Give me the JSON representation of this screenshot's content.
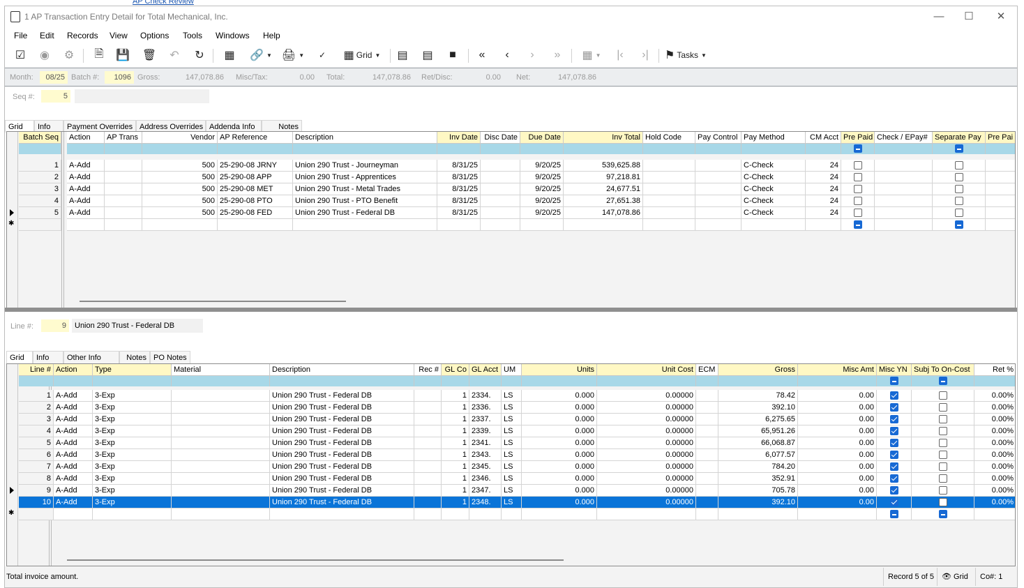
{
  "background_link": "AP Check Review",
  "window": {
    "title": "1 AP Transaction Entry Detail for Total Mechanical, Inc."
  },
  "menu": [
    "File",
    "Edit",
    "Records",
    "View",
    "Options",
    "Tools",
    "Windows",
    "Help"
  ],
  "toolbar": {
    "grid_label": "Grid",
    "tasks_label": "Tasks"
  },
  "header": {
    "month_label": "Month:",
    "month": "08/25",
    "batch_label": "Batch #:",
    "batch": "1096",
    "gross_label": "Gross:",
    "gross": "147,078.86",
    "misctax_label": "Misc/Tax:",
    "misctax": "0.00",
    "total_label": "Total:",
    "total": "147,078.86",
    "retdisc_label": "Ret/Disc:",
    "retdisc": "0.00",
    "net_label": "Net:",
    "net": "147,078.86"
  },
  "seq": {
    "label": "Seq #:",
    "value": "5",
    "desc": ""
  },
  "top_tabs": [
    "Grid",
    "Info",
    "Payment Overrides",
    "Address Overrides",
    "Addenda Info",
    "Notes"
  ],
  "top_grid": {
    "columns": [
      "Batch Seq",
      "Action",
      "AP Trans",
      "Vendor",
      "AP Reference",
      "Description",
      "Inv Date",
      "Disc Date",
      "Due Date",
      "Inv Total",
      "Hold Code",
      "Pay Control",
      "Pay Method",
      "CM Acct",
      "Pre Paid",
      "Check / EPay#",
      "Separate Pay",
      "Pre Pai"
    ],
    "rows": [
      {
        "seq": "1",
        "action": "A-Add",
        "aptrans": "",
        "vendor": "500",
        "ref": "25-290-08 JRNY",
        "desc": "Union 290 Trust - Journeyman",
        "invdate": "8/31/25",
        "discdate": "",
        "duedate": "9/20/25",
        "invtotal": "539,625.88",
        "hold": "",
        "paycontrol": "",
        "paymethod": "C-Check",
        "cmacct": "24"
      },
      {
        "seq": "2",
        "action": "A-Add",
        "aptrans": "",
        "vendor": "500",
        "ref": "25-290-08 APP",
        "desc": "Union 290 Trust - Apprentices",
        "invdate": "8/31/25",
        "discdate": "",
        "duedate": "9/20/25",
        "invtotal": "97,218.81",
        "hold": "",
        "paycontrol": "",
        "paymethod": "C-Check",
        "cmacct": "24"
      },
      {
        "seq": "3",
        "action": "A-Add",
        "aptrans": "",
        "vendor": "500",
        "ref": "25-290-08 MET",
        "desc": "Union 290 Trust - Metal Trades",
        "invdate": "8/31/25",
        "discdate": "",
        "duedate": "9/20/25",
        "invtotal": "24,677.51",
        "hold": "",
        "paycontrol": "",
        "paymethod": "C-Check",
        "cmacct": "24"
      },
      {
        "seq": "4",
        "action": "A-Add",
        "aptrans": "",
        "vendor": "500",
        "ref": "25-290-08 PTO",
        "desc": "Union 290 Trust - PTO Benefit",
        "invdate": "8/31/25",
        "discdate": "",
        "duedate": "9/20/25",
        "invtotal": "27,651.38",
        "hold": "",
        "paycontrol": "",
        "paymethod": "C-Check",
        "cmacct": "24"
      },
      {
        "seq": "5",
        "action": "A-Add",
        "aptrans": "",
        "vendor": "500",
        "ref": "25-290-08 FED",
        "desc": "Union 290 Trust - Federal DB",
        "invdate": "8/31/25",
        "discdate": "",
        "duedate": "9/20/25",
        "invtotal": "147,078.86",
        "hold": "",
        "paycontrol": "",
        "paymethod": "C-Check",
        "cmacct": "24"
      }
    ]
  },
  "line": {
    "label": "Line #:",
    "value": "9",
    "desc": "Union 290 Trust - Federal DB"
  },
  "bottom_tabs": [
    "Grid",
    "Info",
    "Other Info",
    "Notes",
    "PO Notes"
  ],
  "bottom_grid": {
    "columns": [
      "Line #",
      "Action",
      "Type",
      "Material",
      "Description",
      "Rec #",
      "GL Co",
      "GL Acct",
      "UM",
      "Units",
      "Unit Cost",
      "ECM",
      "Gross",
      "Misc Amt",
      "Misc YN",
      "Subj To On-Cost",
      "Ret %"
    ],
    "rows": [
      {
        "line": "1",
        "action": "A-Add",
        "type": "3-Exp",
        "material": "",
        "desc": "Union 290 Trust - Federal DB",
        "rec": "",
        "glco": "1",
        "glacct": "2334.",
        "um": "LS",
        "units": "0.000",
        "unitcost": "0.00000",
        "ecm": "",
        "gross": "78.42",
        "miscamt": "0.00",
        "ret": "0.00%"
      },
      {
        "line": "2",
        "action": "A-Add",
        "type": "3-Exp",
        "material": "",
        "desc": "Union 290 Trust - Federal DB",
        "rec": "",
        "glco": "1",
        "glacct": "2336.",
        "um": "LS",
        "units": "0.000",
        "unitcost": "0.00000",
        "ecm": "",
        "gross": "392.10",
        "miscamt": "0.00",
        "ret": "0.00%"
      },
      {
        "line": "3",
        "action": "A-Add",
        "type": "3-Exp",
        "material": "",
        "desc": "Union 290 Trust - Federal DB",
        "rec": "",
        "glco": "1",
        "glacct": "2337.",
        "um": "LS",
        "units": "0.000",
        "unitcost": "0.00000",
        "ecm": "",
        "gross": "6,275.65",
        "miscamt": "0.00",
        "ret": "0.00%"
      },
      {
        "line": "4",
        "action": "A-Add",
        "type": "3-Exp",
        "material": "",
        "desc": "Union 290 Trust - Federal DB",
        "rec": "",
        "glco": "1",
        "glacct": "2339.",
        "um": "LS",
        "units": "0.000",
        "unitcost": "0.00000",
        "ecm": "",
        "gross": "65,951.26",
        "miscamt": "0.00",
        "ret": "0.00%"
      },
      {
        "line": "5",
        "action": "A-Add",
        "type": "3-Exp",
        "material": "",
        "desc": "Union 290 Trust - Federal DB",
        "rec": "",
        "glco": "1",
        "glacct": "2341.",
        "um": "LS",
        "units": "0.000",
        "unitcost": "0.00000",
        "ecm": "",
        "gross": "66,068.87",
        "miscamt": "0.00",
        "ret": "0.00%"
      },
      {
        "line": "6",
        "action": "A-Add",
        "type": "3-Exp",
        "material": "",
        "desc": "Union 290 Trust - Federal DB",
        "rec": "",
        "glco": "1",
        "glacct": "2343.",
        "um": "LS",
        "units": "0.000",
        "unitcost": "0.00000",
        "ecm": "",
        "gross": "6,077.57",
        "miscamt": "0.00",
        "ret": "0.00%"
      },
      {
        "line": "7",
        "action": "A-Add",
        "type": "3-Exp",
        "material": "",
        "desc": "Union 290 Trust - Federal DB",
        "rec": "",
        "glco": "1",
        "glacct": "2345.",
        "um": "LS",
        "units": "0.000",
        "unitcost": "0.00000",
        "ecm": "",
        "gross": "784.20",
        "miscamt": "0.00",
        "ret": "0.00%"
      },
      {
        "line": "8",
        "action": "A-Add",
        "type": "3-Exp",
        "material": "",
        "desc": "Union 290 Trust - Federal DB",
        "rec": "",
        "glco": "1",
        "glacct": "2346.",
        "um": "LS",
        "units": "0.000",
        "unitcost": "0.00000",
        "ecm": "",
        "gross": "352.91",
        "miscamt": "0.00",
        "ret": "0.00%"
      },
      {
        "line": "9",
        "action": "A-Add",
        "type": "3-Exp",
        "material": "",
        "desc": "Union 290 Trust - Federal DB",
        "rec": "",
        "glco": "1",
        "glacct": "2347.",
        "um": "LS",
        "units": "0.000",
        "unitcost": "0.00000",
        "ecm": "",
        "gross": "705.78",
        "miscamt": "0.00",
        "ret": "0.00%"
      },
      {
        "line": "10",
        "action": "A-Add",
        "type": "3-Exp",
        "material": "",
        "desc": "Union 290 Trust - Federal DB",
        "rec": "",
        "glco": "1",
        "glacct": "2348.",
        "um": "LS",
        "units": "0.000",
        "unitcost": "0.00000",
        "ecm": "",
        "gross": "392.10",
        "miscamt": "0.00",
        "ret": "0.00%"
      }
    ]
  },
  "status": {
    "message": "Total invoice amount.",
    "record": "Record 5 of 5",
    "view": "Grid",
    "company": "Co#: 1"
  },
  "colors": {
    "selection": "#0a74d8",
    "required_header": "#fff8c4",
    "filter_row": "#a8d8e8",
    "checkbox": "#1769d4"
  }
}
